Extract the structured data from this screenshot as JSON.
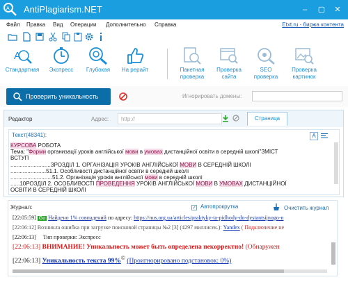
{
  "app": {
    "title": "AntiPlagiarism.NET",
    "window_controls": [
      "–",
      "▢",
      "✕"
    ]
  },
  "menu": {
    "items": [
      "Файл",
      "Правка",
      "Вид",
      "Операции",
      "Дополнительно",
      "Справка"
    ],
    "etxt_link": "Etxt.ru - биржа контента"
  },
  "toolbar_icons": [
    "folder-icon",
    "new-file-icon",
    "save-icon",
    "cut-icon",
    "copy-icon",
    "paste-icon",
    "settings-icon",
    "info-icon"
  ],
  "ribbon": {
    "buttons": [
      "Стандартная",
      "Экспресс",
      "Глубокая",
      "На рерайт"
    ],
    "tools": [
      [
        "Пакетная",
        "проверка"
      ],
      [
        "Проверка",
        "сайта"
      ],
      [
        "SEO",
        "проверка"
      ],
      [
        "Проверка",
        "картинок"
      ]
    ]
  },
  "actions": {
    "check_label": "Проверить уникальность",
    "ignore_domains_label": "Игнорировать домены:",
    "ignore_domains_value": ""
  },
  "editor": {
    "title": "Редактор",
    "address_label": "Адрес:",
    "address_placeholder": "http://",
    "page_tab": "Страница",
    "text_count": "Текст(48341):",
    "format_label": "A"
  },
  "document": {
    "lines": [
      [
        [
          "hl",
          "КУРСОВА"
        ],
        [
          "",
          " РОБОТА"
        ]
      ],
      [
        [
          "",
          "Тема: \""
        ],
        [
          "hl",
          "Форми"
        ],
        [
          "",
          " организації уроків англійської "
        ],
        [
          "hl",
          "мови"
        ],
        [
          "",
          " в "
        ],
        [
          "hl",
          "умовах"
        ],
        [
          "",
          " дистанційної освіти в середній школі\"ЗМІСТ"
        ]
      ],
      [
        [
          "",
          "ВСТУП"
        ]
      ],
      [
        [
          "",
          "..........................ЗРОЗДІЛ 1. ОРГАНІЗАЦІЯ УРОКІВ АНГЛІЙСЬКОЇ "
        ],
        [
          "hl",
          "МОВИ"
        ],
        [
          "",
          " В СЕРЕДНІЙ ШКОЛІ"
        ]
      ],
      [
        [
          "",
          ".......................51.1. Особливості дистанційної освіти в середній школі"
        ]
      ],
      [
        [
          "",
          "...........................51.2. Організація уроків англійської "
        ],
        [
          "hl",
          "мови"
        ],
        [
          "",
          " в середній школі"
        ]
      ],
      [
        [
          "",
          "......10РОЗДІЛ 2. ОСОБЛИВОСТІ "
        ],
        [
          "hl",
          "ПРОВЕДЕННЯ"
        ],
        [
          "",
          " УРОКІВ АНГЛІЙСЬКОЇ "
        ],
        [
          "hl",
          "МОВИ"
        ],
        [
          "",
          " В "
        ],
        [
          "hl",
          "УМОВАХ"
        ],
        [
          "",
          " ДИСТАНЦІЙНОЇ"
        ]
      ],
      [
        [
          "",
          "ОСВІТИ В СЕРЕДНІЙ ШКОЛІ"
        ]
      ]
    ]
  },
  "journal": {
    "title": "Журнал:",
    "autoscroll_label": "Автопрокрутка",
    "autoscroll_checked": "✓",
    "clear_label": "Очистить журнал",
    "entries": {
      "e1_time": "[22:05:59]",
      "e1_badge": "Go",
      "e1_text1": "Найдено 1% совпадений",
      "e1_text2": " по адресу: ",
      "e1_url": "https://nus.org.ua/articles/praktyky-ta-pidhody-do-dystantsijnogo-n",
      "e2_time": "[22:06:12]",
      "e2_text": " Возникла ошибка при загрузке поисковой страницы №2 [3] (4297 миллисек.): ",
      "e2_link": "Yandex",
      "e2_tail": " ( Подключение не",
      "e3_time": "[22:06:13]",
      "e3_text": "Тип проверки: Экспресс",
      "e4_time": "[22:06:13]",
      "e4_warn": " ВНИМАНИЕ! Уникальность может быть определена некорректно! ",
      "e4_tail": "(Обнаружен",
      "e5_time": "[22:06:13]",
      "e5_text": "Уникальность текста 99%",
      "e5_mark": "©",
      "e5_tail": "(Проигнорировано подстановок: 0%)"
    }
  },
  "colors": {
    "titlebar": "#1b9ee0",
    "accent": "#1a8fd6",
    "check_button": "#0b6ea8",
    "highlight": "#f6dbe9"
  }
}
